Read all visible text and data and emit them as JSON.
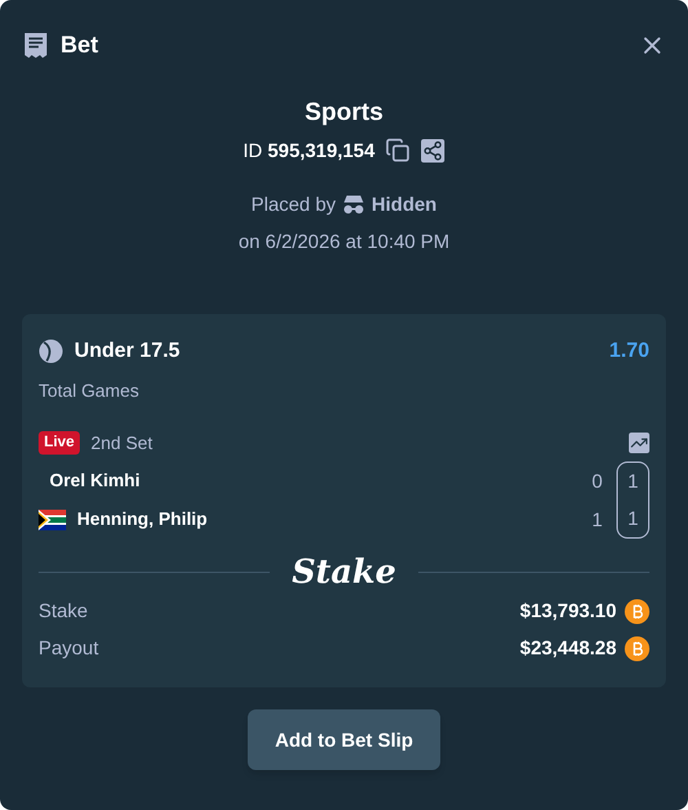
{
  "header": {
    "title": "Bet"
  },
  "summary": {
    "title": "Sports",
    "id": "ID **595,319,154**",
    "placed_by": "Placed by",
    "user": "Hidden",
    "date": "on 6/2/2026 at 10:40 PM"
  },
  "bet": {
    "selection": "Under 17.5",
    "odds": "1.70",
    "market": "Total Games",
    "live": true,
    "live_label": "Live",
    "period": "2nd Set",
    "players": [
      {
        "name": "Orel Kimhi",
        "flag": false,
        "scores": [
          "0",
          "1"
        ]
      },
      {
        "name": "Henning, Philip",
        "flag": true,
        "scores": [
          "1",
          "1"
        ]
      }
    ],
    "brand": "Stake",
    "totals": [
      {
        "label": "Stake",
        "amount": "$13,793.10"
      },
      {
        "label": "Payout",
        "amount": "$23,448.28"
      }
    ]
  },
  "button": "Add to Bet Slip"
}
